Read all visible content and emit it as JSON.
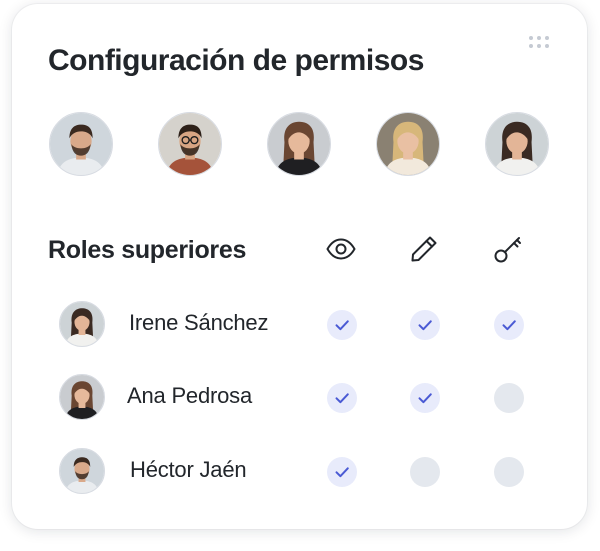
{
  "card": {
    "title": "Configuración de permisos",
    "more_icon": "more-dots-icon"
  },
  "team_avatars": [
    {
      "icon": "avatar-man-beard",
      "skin": "#d9a98a",
      "hair": "#3b2a20",
      "shirt": "#e9ecef",
      "bg": "#cfd6dc"
    },
    {
      "icon": "avatar-man-glasses",
      "skin": "#d8a583",
      "hair": "#2d2018",
      "shirt": "#a5533a",
      "bg": "#d5d2cc"
    },
    {
      "icon": "avatar-woman-dark-top",
      "skin": "#e6b99b",
      "hair": "#6a4632",
      "shirt": "#1f1f22",
      "bg": "#c9ccd0"
    },
    {
      "icon": "avatar-woman-blonde",
      "skin": "#e9c0a3",
      "hair": "#d7b77a",
      "shirt": "#f2e9dc",
      "bg": "#8a8172"
    },
    {
      "icon": "avatar-woman-dark-hair",
      "skin": "#e3b597",
      "hair": "#3a2a22",
      "shirt": "#f1f1ef",
      "bg": "#cdd3d6"
    }
  ],
  "roles": {
    "section_title": "Roles superiores",
    "columns": [
      {
        "icon": "eye-icon",
        "permission": "view"
      },
      {
        "icon": "pencil-icon",
        "permission": "edit"
      },
      {
        "icon": "key-icon",
        "permission": "admin"
      }
    ],
    "users": [
      {
        "name": "Irene Sánchez",
        "avatar": "avatar-woman-dark-hair",
        "skin": "#e3b597",
        "hair": "#3a2a22",
        "shirt": "#f1f1ef",
        "bg": "#cdd3d6",
        "permissions": [
          true,
          true,
          true
        ]
      },
      {
        "name": "Ana Pedrosa",
        "avatar": "avatar-woman-dark-top",
        "skin": "#e6b99b",
        "hair": "#6a4632",
        "shirt": "#1f1f22",
        "bg": "#c9ccd0",
        "permissions": [
          true,
          true,
          false
        ]
      },
      {
        "name": "Héctor Jaén",
        "avatar": "avatar-man-beard",
        "skin": "#d9a98a",
        "hair": "#3b2a20",
        "shirt": "#e9ecef",
        "bg": "#cfd6dc",
        "permissions": [
          true,
          false,
          false
        ]
      }
    ]
  },
  "colors": {
    "check": "#4a5ad4",
    "check_bg": "#e8ebfb",
    "empty_bg": "#e4e8ee",
    "text": "#22262b"
  }
}
